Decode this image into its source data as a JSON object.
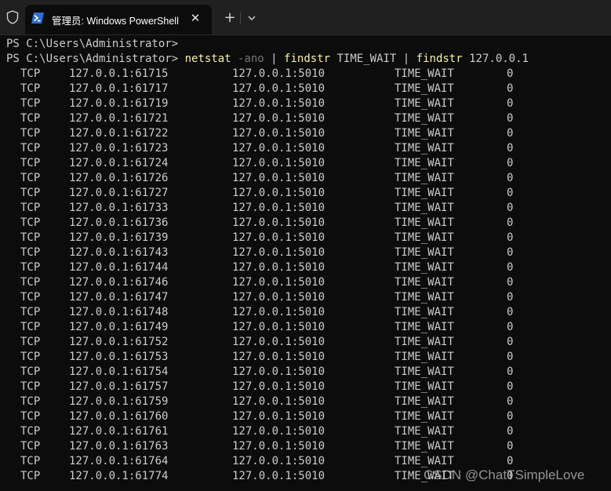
{
  "window": {
    "tab_title": "管理员: Windows PowerShell",
    "icons": [
      "shield-icon",
      "powershell-icon",
      "close-icon",
      "plus-icon",
      "chevron-down-icon"
    ],
    "new_tab_label": "+",
    "close_label": "✕"
  },
  "terminal": {
    "prompt1": "PS C:\\Users\\Administrator>",
    "prompt2": "PS C:\\Users\\Administrator> ",
    "command": {
      "name1": "netstat",
      "flag": " -ano",
      "pipe1": " | ",
      "name2": "findstr",
      "arg1": " TIME_WAIT",
      "pipe2": " | ",
      "name3": "findstr",
      "arg2": " 127.0.0.1"
    },
    "rows": [
      {
        "proto": "TCP",
        "local": "127.0.0.1:61715",
        "foreign": "127.0.0.1:5010",
        "state": "TIME_WAIT",
        "pid": "0"
      },
      {
        "proto": "TCP",
        "local": "127.0.0.1:61717",
        "foreign": "127.0.0.1:5010",
        "state": "TIME_WAIT",
        "pid": "0"
      },
      {
        "proto": "TCP",
        "local": "127.0.0.1:61719",
        "foreign": "127.0.0.1:5010",
        "state": "TIME_WAIT",
        "pid": "0"
      },
      {
        "proto": "TCP",
        "local": "127.0.0.1:61721",
        "foreign": "127.0.0.1:5010",
        "state": "TIME_WAIT",
        "pid": "0"
      },
      {
        "proto": "TCP",
        "local": "127.0.0.1:61722",
        "foreign": "127.0.0.1:5010",
        "state": "TIME_WAIT",
        "pid": "0"
      },
      {
        "proto": "TCP",
        "local": "127.0.0.1:61723",
        "foreign": "127.0.0.1:5010",
        "state": "TIME_WAIT",
        "pid": "0"
      },
      {
        "proto": "TCP",
        "local": "127.0.0.1:61724",
        "foreign": "127.0.0.1:5010",
        "state": "TIME_WAIT",
        "pid": "0"
      },
      {
        "proto": "TCP",
        "local": "127.0.0.1:61726",
        "foreign": "127.0.0.1:5010",
        "state": "TIME_WAIT",
        "pid": "0"
      },
      {
        "proto": "TCP",
        "local": "127.0.0.1:61727",
        "foreign": "127.0.0.1:5010",
        "state": "TIME_WAIT",
        "pid": "0"
      },
      {
        "proto": "TCP",
        "local": "127.0.0.1:61733",
        "foreign": "127.0.0.1:5010",
        "state": "TIME_WAIT",
        "pid": "0"
      },
      {
        "proto": "TCP",
        "local": "127.0.0.1:61736",
        "foreign": "127.0.0.1:5010",
        "state": "TIME_WAIT",
        "pid": "0"
      },
      {
        "proto": "TCP",
        "local": "127.0.0.1:61739",
        "foreign": "127.0.0.1:5010",
        "state": "TIME_WAIT",
        "pid": "0"
      },
      {
        "proto": "TCP",
        "local": "127.0.0.1:61743",
        "foreign": "127.0.0.1:5010",
        "state": "TIME_WAIT",
        "pid": "0"
      },
      {
        "proto": "TCP",
        "local": "127.0.0.1:61744",
        "foreign": "127.0.0.1:5010",
        "state": "TIME_WAIT",
        "pid": "0"
      },
      {
        "proto": "TCP",
        "local": "127.0.0.1:61746",
        "foreign": "127.0.0.1:5010",
        "state": "TIME_WAIT",
        "pid": "0"
      },
      {
        "proto": "TCP",
        "local": "127.0.0.1:61747",
        "foreign": "127.0.0.1:5010",
        "state": "TIME_WAIT",
        "pid": "0"
      },
      {
        "proto": "TCP",
        "local": "127.0.0.1:61748",
        "foreign": "127.0.0.1:5010",
        "state": "TIME_WAIT",
        "pid": "0"
      },
      {
        "proto": "TCP",
        "local": "127.0.0.1:61749",
        "foreign": "127.0.0.1:5010",
        "state": "TIME_WAIT",
        "pid": "0"
      },
      {
        "proto": "TCP",
        "local": "127.0.0.1:61752",
        "foreign": "127.0.0.1:5010",
        "state": "TIME_WAIT",
        "pid": "0"
      },
      {
        "proto": "TCP",
        "local": "127.0.0.1:61753",
        "foreign": "127.0.0.1:5010",
        "state": "TIME_WAIT",
        "pid": "0"
      },
      {
        "proto": "TCP",
        "local": "127.0.0.1:61754",
        "foreign": "127.0.0.1:5010",
        "state": "TIME_WAIT",
        "pid": "0"
      },
      {
        "proto": "TCP",
        "local": "127.0.0.1:61757",
        "foreign": "127.0.0.1:5010",
        "state": "TIME_WAIT",
        "pid": "0"
      },
      {
        "proto": "TCP",
        "local": "127.0.0.1:61759",
        "foreign": "127.0.0.1:5010",
        "state": "TIME_WAIT",
        "pid": "0"
      },
      {
        "proto": "TCP",
        "local": "127.0.0.1:61760",
        "foreign": "127.0.0.1:5010",
        "state": "TIME_WAIT",
        "pid": "0"
      },
      {
        "proto": "TCP",
        "local": "127.0.0.1:61761",
        "foreign": "127.0.0.1:5010",
        "state": "TIME_WAIT",
        "pid": "0"
      },
      {
        "proto": "TCP",
        "local": "127.0.0.1:61763",
        "foreign": "127.0.0.1:5010",
        "state": "TIME_WAIT",
        "pid": "0"
      },
      {
        "proto": "TCP",
        "local": "127.0.0.1:61764",
        "foreign": "127.0.0.1:5010",
        "state": "TIME_WAIT",
        "pid": "0"
      },
      {
        "proto": "TCP",
        "local": "127.0.0.1:61774",
        "foreign": "127.0.0.1:5010",
        "state": "TIME_WAIT",
        "pid": "0"
      }
    ]
  },
  "watermark": "CSDN @ChatTSimpleLove",
  "colors": {
    "background": "#0c0c0c",
    "tab_bar": "#202020",
    "text": "#cccccc",
    "command_name": "#f9f1a5",
    "command_flag": "#767676",
    "powershell_blue": "#2d6fd6"
  }
}
